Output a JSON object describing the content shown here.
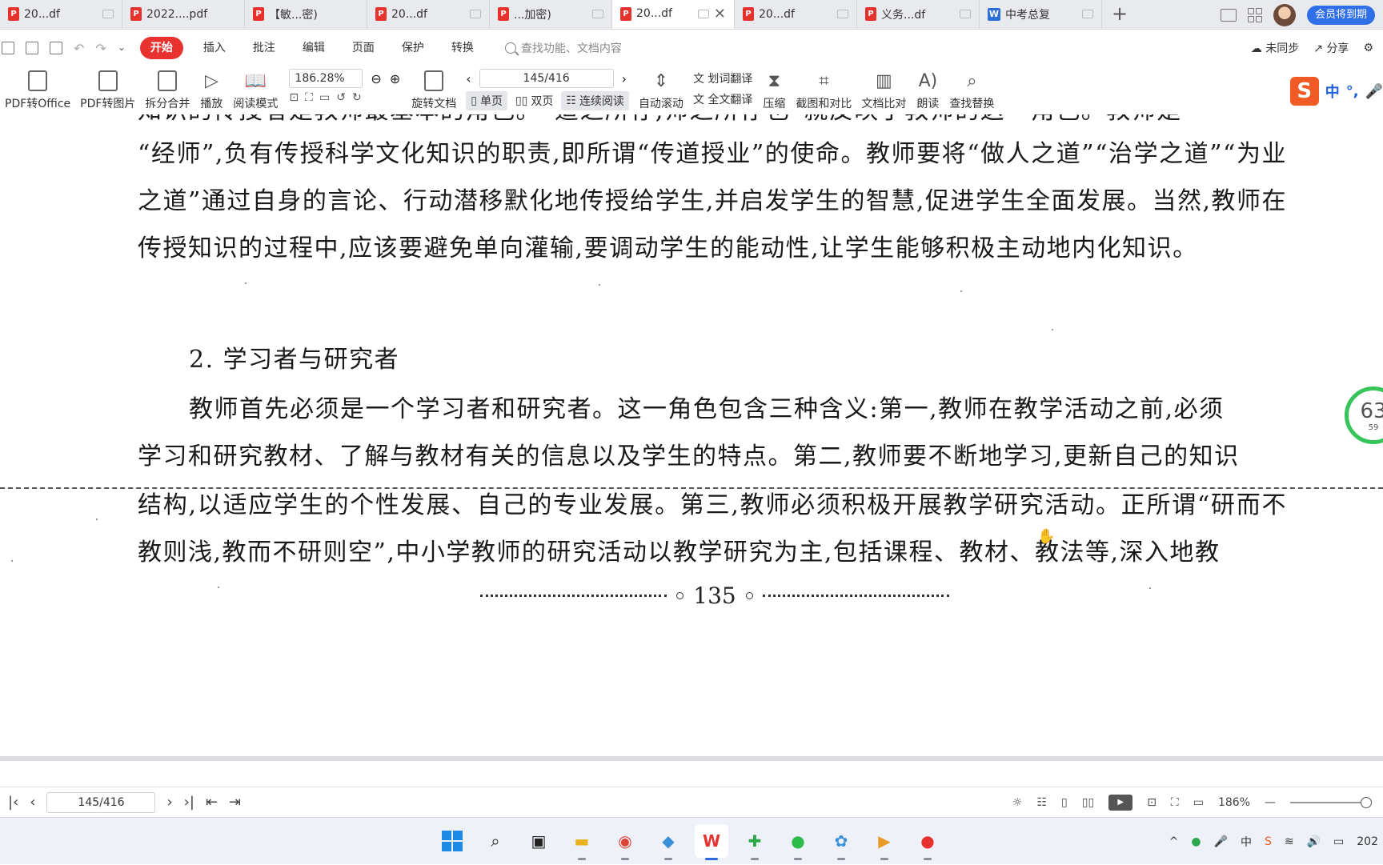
{
  "tabs": [
    {
      "label": "20...df",
      "active": false
    },
    {
      "label": "2022....pdf",
      "active": false
    },
    {
      "label": "【敏...密)",
      "active": false
    },
    {
      "label": "20...df",
      "active": false
    },
    {
      "label": "...加密)",
      "active": false
    },
    {
      "label": "20...df",
      "active": true
    },
    {
      "label": "20...df",
      "active": false
    },
    {
      "label": "义务...df",
      "active": false
    },
    {
      "label": "中考总复",
      "active": false,
      "type": "word"
    }
  ],
  "tabbar": {
    "add_label": "+",
    "vip_label": "会员将到期",
    "close_glyph": "✕"
  },
  "menu": {
    "items": [
      "开始",
      "插入",
      "批注",
      "编辑",
      "页面",
      "保护",
      "转换"
    ],
    "search_placeholder": "查找功能、文档内容",
    "sync_label": "未同步",
    "share_label": "分享"
  },
  "toolbar": {
    "pdf_to_office": "PDF转Office",
    "pdf_to_image": "PDF转图片",
    "split_merge": "拆分合并",
    "play": "播放",
    "read_mode": "阅读模式",
    "zoom_value": "186.28%",
    "page_value": "145/416",
    "rotate": "旋转文档",
    "single_page": "单页",
    "double_page": "双页",
    "continuous": "连续阅读",
    "auto_scroll": "自动滚动",
    "word_translate": "划词翻译",
    "full_translate": "全文翻译",
    "compress": "压缩",
    "screenshot_compare": "截图和对比",
    "doc_compare": "文档比对",
    "read_aloud": "朗读",
    "find_replace": "查找替换"
  },
  "ime": {
    "logo": "S",
    "lang": "中",
    "punct": "°,"
  },
  "document": {
    "top_cut_line": "知识的传授者是教师最基本的角色。“道之所存,师之所存也”就反映了教师的这一角色。教师是",
    "para1": "“经师”,负有传授科学文化知识的职责,即所谓“传道授业”的使命。教师要将“做人之道”“治学之道”“为业之道”通过自身的言论、行动潜移默化地传授给学生,并启发学生的智慧,促进学生全面发展。当然,教师在传授知识的过程中,应该要避免单向灌输,要调动学生的能动性,让学生能够积极主动地内化知识。",
    "heading": "2. 学习者与研究者",
    "para2_first": "教师首先必须是一个学习者和研究者。这一角色包含三种含义:第一,教师在教学活动之前,必须",
    "para2_line2": "学习和研究教材、了解与教材有关的信息以及学生的特点。第二,教师要不断地学习,更新自己的知识",
    "para2_rest": "结构,以适应学生的个性发展、自己的专业发展。第三,教师必须积极开展教学研究活动。正所谓“研而不教则浅,教而不研则空”,中小学教师的研究活动以教学研究为主,包括课程、教材、教法等,深入地教",
    "page_number": "135"
  },
  "progress_widget": {
    "big": "63",
    "small": "59"
  },
  "statusbar": {
    "page_value": "145/416",
    "zoom_value": "186%"
  },
  "taskbar": {
    "apps": [
      "start-icon",
      "search-icon",
      "task-view-icon",
      "file-explorer-icon",
      "chrome-icon",
      "app-icon",
      "wps-icon",
      "add-icon",
      "wechat-icon",
      "cloud-icon",
      "media-icon",
      "recorder-icon"
    ],
    "clock": "202",
    "ime_label": "中"
  },
  "colors": {
    "accent": "#e8322f",
    "vip": "#2f6fe8",
    "progress": "#37c45a"
  }
}
